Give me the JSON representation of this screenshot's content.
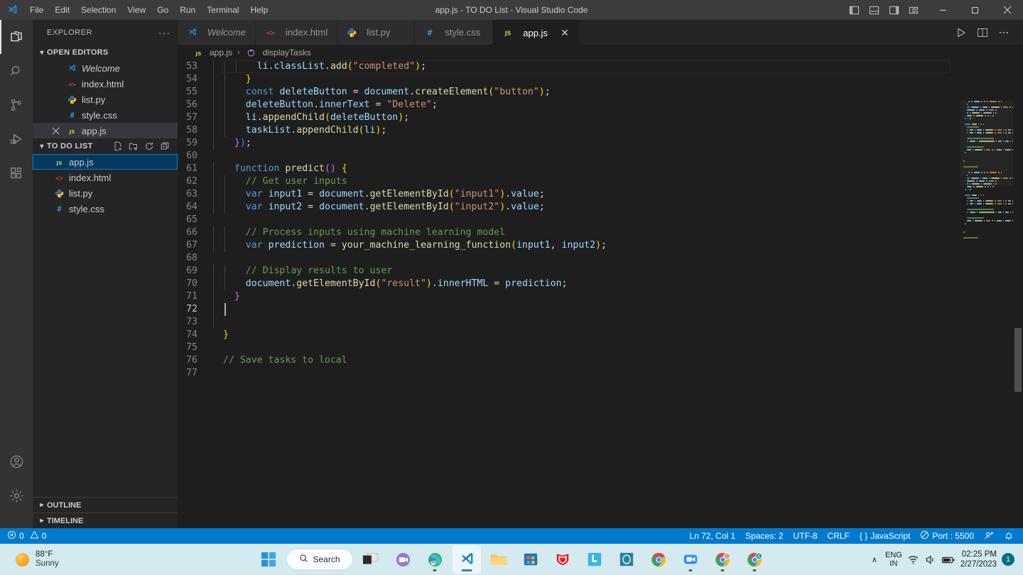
{
  "window": {
    "title": "app.js - TO DO List - Visual Studio Code",
    "menu": [
      "File",
      "Edit",
      "Selection",
      "View",
      "Go",
      "Run",
      "Terminal",
      "Help"
    ],
    "controls": {
      "minimize": "—",
      "maximize": "❐",
      "close": "✕"
    },
    "layout_icons": [
      "toggle-primary-sidebar",
      "toggle-panel",
      "toggle-secondary-sidebar",
      "customize-layout"
    ]
  },
  "activitybar": {
    "items": [
      {
        "name": "explorer",
        "label": "Explorer",
        "active": true
      },
      {
        "name": "search",
        "label": "Search",
        "active": false
      },
      {
        "name": "source-control",
        "label": "Source Control",
        "active": false
      },
      {
        "name": "run-debug",
        "label": "Run and Debug",
        "active": false
      },
      {
        "name": "extensions",
        "label": "Extensions",
        "active": false
      }
    ],
    "bottom": [
      {
        "name": "accounts",
        "label": "Accounts"
      },
      {
        "name": "settings",
        "label": "Manage"
      }
    ]
  },
  "sidebar": {
    "title": "EXPLORER",
    "more_label": "···",
    "open_editors": {
      "label": "OPEN EDITORS",
      "expanded": true,
      "items": [
        {
          "name": "Welcome",
          "icon": "vscode-icon",
          "italic": true,
          "dirty": false,
          "active": false
        },
        {
          "name": "index.html",
          "icon": "html-icon",
          "italic": false,
          "dirty": false,
          "active": false
        },
        {
          "name": "list.py",
          "icon": "python-icon",
          "italic": false,
          "dirty": false,
          "active": false
        },
        {
          "name": "style.css",
          "icon": "css-icon",
          "italic": false,
          "dirty": false,
          "active": false
        },
        {
          "name": "app.js",
          "icon": "js-icon",
          "italic": false,
          "dirty": false,
          "active": true
        }
      ]
    },
    "project": {
      "label": "TO DO LIST",
      "expanded": true,
      "actions": [
        "new-file-icon",
        "new-folder-icon",
        "refresh-icon",
        "collapse-all-icon"
      ],
      "items": [
        {
          "name": "app.js",
          "icon": "js-icon",
          "selected": true
        },
        {
          "name": "index.html",
          "icon": "html-icon",
          "selected": false
        },
        {
          "name": "list.py",
          "icon": "python-icon",
          "selected": false
        },
        {
          "name": "style.css",
          "icon": "css-icon",
          "selected": false
        }
      ]
    },
    "collapsed_sections": [
      {
        "label": "OUTLINE"
      },
      {
        "label": "TIMELINE"
      }
    ]
  },
  "editor": {
    "tabs": [
      {
        "label": "Welcome",
        "icon": "vscode-icon",
        "italic": true,
        "active": false,
        "closable": false
      },
      {
        "label": "index.html",
        "icon": "html-icon",
        "italic": false,
        "active": false,
        "closable": false
      },
      {
        "label": "list.py",
        "icon": "python-icon",
        "italic": false,
        "active": false,
        "closable": false
      },
      {
        "label": "style.css",
        "icon": "css-icon",
        "italic": false,
        "active": false,
        "closable": false
      },
      {
        "label": "app.js",
        "icon": "js-icon",
        "italic": false,
        "active": true,
        "closable": true
      }
    ],
    "tab_close_glyph": "✕",
    "actions": [
      "run-icon",
      "split-editor-icon",
      "more-actions-icon"
    ],
    "breadcrumb": {
      "file_icon": "js-icon",
      "file": "app.js",
      "separator": "›",
      "symbol_icon": "method-icon",
      "symbol": "displayTasks"
    },
    "first_line_number": 53,
    "active_line": 72,
    "lines": [
      {
        "n": 53,
        "indent": 3,
        "tokens": [
          {
            "t": "li",
            "c": "t-var"
          },
          {
            "t": ".",
            "c": "t-plain"
          },
          {
            "t": "classList",
            "c": "t-var"
          },
          {
            "t": ".",
            "c": "t-plain"
          },
          {
            "t": "add",
            "c": "t-fn"
          },
          {
            "t": "(",
            "c": "t-b1"
          },
          {
            "t": "\"completed\"",
            "c": "t-str"
          },
          {
            "t": ")",
            "c": "t-b1"
          },
          {
            "t": ";",
            "c": "t-plain"
          }
        ]
      },
      {
        "n": 54,
        "indent": 2,
        "tokens": [
          {
            "t": "}",
            "c": "t-b1"
          }
        ]
      },
      {
        "n": 55,
        "indent": 2,
        "tokens": [
          {
            "t": "const",
            "c": "t-key"
          },
          {
            "t": " ",
            "c": "t-plain"
          },
          {
            "t": "deleteButton",
            "c": "t-var"
          },
          {
            "t": " ",
            "c": "t-plain"
          },
          {
            "t": "=",
            "c": "t-plain"
          },
          {
            "t": " ",
            "c": "t-plain"
          },
          {
            "t": "document",
            "c": "t-var"
          },
          {
            "t": ".",
            "c": "t-plain"
          },
          {
            "t": "createElement",
            "c": "t-fn"
          },
          {
            "t": "(",
            "c": "t-b1"
          },
          {
            "t": "\"button\"",
            "c": "t-str"
          },
          {
            "t": ")",
            "c": "t-b1"
          },
          {
            "t": ";",
            "c": "t-plain"
          }
        ]
      },
      {
        "n": 56,
        "indent": 2,
        "tokens": [
          {
            "t": "deleteButton",
            "c": "t-var"
          },
          {
            "t": ".",
            "c": "t-plain"
          },
          {
            "t": "innerText",
            "c": "t-var"
          },
          {
            "t": " ",
            "c": "t-plain"
          },
          {
            "t": "=",
            "c": "t-plain"
          },
          {
            "t": " ",
            "c": "t-plain"
          },
          {
            "t": "\"Delete\"",
            "c": "t-str"
          },
          {
            "t": ";",
            "c": "t-plain"
          }
        ]
      },
      {
        "n": 57,
        "indent": 2,
        "tokens": [
          {
            "t": "li",
            "c": "t-var"
          },
          {
            "t": ".",
            "c": "t-plain"
          },
          {
            "t": "appendChild",
            "c": "t-fn"
          },
          {
            "t": "(",
            "c": "t-b1"
          },
          {
            "t": "deleteButton",
            "c": "t-var"
          },
          {
            "t": ")",
            "c": "t-b1"
          },
          {
            "t": ";",
            "c": "t-plain"
          }
        ]
      },
      {
        "n": 58,
        "indent": 2,
        "tokens": [
          {
            "t": "taskList",
            "c": "t-var"
          },
          {
            "t": ".",
            "c": "t-plain"
          },
          {
            "t": "appendChild",
            "c": "t-fn"
          },
          {
            "t": "(",
            "c": "t-b1"
          },
          {
            "t": "li",
            "c": "t-var"
          },
          {
            "t": ")",
            "c": "t-b1"
          },
          {
            "t": ";",
            "c": "t-plain"
          }
        ]
      },
      {
        "n": 59,
        "indent": 1,
        "tokens": [
          {
            "t": "}",
            "c": "t-b2"
          },
          {
            "t": ")",
            "c": "t-b3"
          },
          {
            "t": ";",
            "c": "t-plain"
          }
        ]
      },
      {
        "n": 60,
        "indent": 0,
        "tokens": []
      },
      {
        "n": 61,
        "indent": 1,
        "tokens": [
          {
            "t": "function",
            "c": "t-key"
          },
          {
            "t": " ",
            "c": "t-plain"
          },
          {
            "t": "predict",
            "c": "t-fn"
          },
          {
            "t": "(",
            "c": "t-b2"
          },
          {
            "t": ")",
            "c": "t-b2"
          },
          {
            "t": " ",
            "c": "t-plain"
          },
          {
            "t": "{",
            "c": "t-b1"
          }
        ]
      },
      {
        "n": 62,
        "indent": 2,
        "tokens": [
          {
            "t": "// Get user inputs",
            "c": "t-com"
          }
        ]
      },
      {
        "n": 63,
        "indent": 2,
        "tokens": [
          {
            "t": "var",
            "c": "t-key"
          },
          {
            "t": " ",
            "c": "t-plain"
          },
          {
            "t": "input1",
            "c": "t-var"
          },
          {
            "t": " ",
            "c": "t-plain"
          },
          {
            "t": "=",
            "c": "t-plain"
          },
          {
            "t": " ",
            "c": "t-plain"
          },
          {
            "t": "document",
            "c": "t-var"
          },
          {
            "t": ".",
            "c": "t-plain"
          },
          {
            "t": "getElementById",
            "c": "t-fn"
          },
          {
            "t": "(",
            "c": "t-b1"
          },
          {
            "t": "\"input1\"",
            "c": "t-str"
          },
          {
            "t": ")",
            "c": "t-b1"
          },
          {
            "t": ".",
            "c": "t-plain"
          },
          {
            "t": "value",
            "c": "t-var"
          },
          {
            "t": ";",
            "c": "t-plain"
          }
        ]
      },
      {
        "n": 64,
        "indent": 2,
        "tokens": [
          {
            "t": "var",
            "c": "t-key"
          },
          {
            "t": " ",
            "c": "t-plain"
          },
          {
            "t": "input2",
            "c": "t-var"
          },
          {
            "t": " ",
            "c": "t-plain"
          },
          {
            "t": "=",
            "c": "t-plain"
          },
          {
            "t": " ",
            "c": "t-plain"
          },
          {
            "t": "document",
            "c": "t-var"
          },
          {
            "t": ".",
            "c": "t-plain"
          },
          {
            "t": "getElementById",
            "c": "t-fn"
          },
          {
            "t": "(",
            "c": "t-b1"
          },
          {
            "t": "\"input2\"",
            "c": "t-str"
          },
          {
            "t": ")",
            "c": "t-b1"
          },
          {
            "t": ".",
            "c": "t-plain"
          },
          {
            "t": "value",
            "c": "t-var"
          },
          {
            "t": ";",
            "c": "t-plain"
          }
        ]
      },
      {
        "n": 65,
        "indent": 0,
        "tokens": []
      },
      {
        "n": 66,
        "indent": 2,
        "tokens": [
          {
            "t": "// Process inputs using machine learning model",
            "c": "t-com"
          }
        ]
      },
      {
        "n": 67,
        "indent": 2,
        "tokens": [
          {
            "t": "var",
            "c": "t-key"
          },
          {
            "t": " ",
            "c": "t-plain"
          },
          {
            "t": "prediction",
            "c": "t-var"
          },
          {
            "t": " ",
            "c": "t-plain"
          },
          {
            "t": "=",
            "c": "t-plain"
          },
          {
            "t": " ",
            "c": "t-plain"
          },
          {
            "t": "your_machine_learning_function",
            "c": "t-fn"
          },
          {
            "t": "(",
            "c": "t-b1"
          },
          {
            "t": "input1",
            "c": "t-var"
          },
          {
            "t": ",",
            "c": "t-plain"
          },
          {
            "t": " ",
            "c": "t-plain"
          },
          {
            "t": "input2",
            "c": "t-var"
          },
          {
            "t": ")",
            "c": "t-b1"
          },
          {
            "t": ";",
            "c": "t-plain"
          }
        ]
      },
      {
        "n": 68,
        "indent": 0,
        "tokens": []
      },
      {
        "n": 69,
        "indent": 2,
        "tokens": [
          {
            "t": "// Display results to user",
            "c": "t-com"
          }
        ]
      },
      {
        "n": 70,
        "indent": 2,
        "tokens": [
          {
            "t": "document",
            "c": "t-var"
          },
          {
            "t": ".",
            "c": "t-plain"
          },
          {
            "t": "getElementById",
            "c": "t-fn"
          },
          {
            "t": "(",
            "c": "t-b1"
          },
          {
            "t": "\"result\"",
            "c": "t-str"
          },
          {
            "t": ")",
            "c": "t-b1"
          },
          {
            "t": ".",
            "c": "t-plain"
          },
          {
            "t": "innerHTML",
            "c": "t-var"
          },
          {
            "t": " ",
            "c": "t-plain"
          },
          {
            "t": "=",
            "c": "t-plain"
          },
          {
            "t": " ",
            "c": "t-plain"
          },
          {
            "t": "prediction",
            "c": "t-var"
          },
          {
            "t": ";",
            "c": "t-plain"
          }
        ]
      },
      {
        "n": 71,
        "indent": 1,
        "tokens": [
          {
            "t": "}",
            "c": "t-b2"
          }
        ]
      },
      {
        "n": 72,
        "indent": 1,
        "tokens": []
      },
      {
        "n": 73,
        "indent": 1,
        "tokens": []
      },
      {
        "n": 74,
        "indent": 0,
        "tokens": [
          {
            "t": "}",
            "c": "t-b1"
          }
        ]
      },
      {
        "n": 75,
        "indent": 0,
        "tokens": []
      },
      {
        "n": 76,
        "indent": 0,
        "tokens": [
          {
            "t": "// Save tasks to local",
            "c": "t-com"
          }
        ]
      },
      {
        "n": 77,
        "indent": 0,
        "tokens": []
      }
    ]
  },
  "statusbar": {
    "errors": "0",
    "warnings": "0",
    "position": "Ln 72, Col 1",
    "spaces": "Spaces: 2",
    "encoding": "UTF-8",
    "eol": "CRLF",
    "language": "JavaScript",
    "language_icon": "{ }",
    "port": "Port : 5500",
    "icons": [
      "remote-icon",
      "bell-icon"
    ],
    "background": "#007acc"
  },
  "taskbar": {
    "weather": {
      "temperature": "88°F",
      "condition": "Sunny",
      "icon": "sun-icon"
    },
    "start_label": "start-button",
    "search": {
      "label": "Search",
      "icon": "search-icon"
    },
    "apps": [
      {
        "name": "task-view",
        "running": false
      },
      {
        "name": "microsoft-teams",
        "running": false
      },
      {
        "name": "microsoft-edge",
        "running": true
      },
      {
        "name": "visual-studio-code",
        "running": true,
        "active": true
      },
      {
        "name": "file-explorer",
        "running": false
      },
      {
        "name": "microsoft-store",
        "running": false
      },
      {
        "name": "mcafee",
        "running": false
      },
      {
        "name": "linkedin",
        "running": false
      },
      {
        "name": "outlook",
        "running": false
      },
      {
        "name": "google-chrome",
        "running": false
      },
      {
        "name": "zoom",
        "running": false
      },
      {
        "name": "chrome-profile-1",
        "running": true
      },
      {
        "name": "chrome-profile-2",
        "running": true
      }
    ],
    "tray": {
      "chevron": "∧",
      "language": {
        "line1": "ENG",
        "line2": "IN"
      },
      "icons": [
        "wifi-icon",
        "volume-icon",
        "battery-icon"
      ],
      "time": "02:25 PM",
      "date": "2/27/2023",
      "notification_count": "1"
    }
  }
}
